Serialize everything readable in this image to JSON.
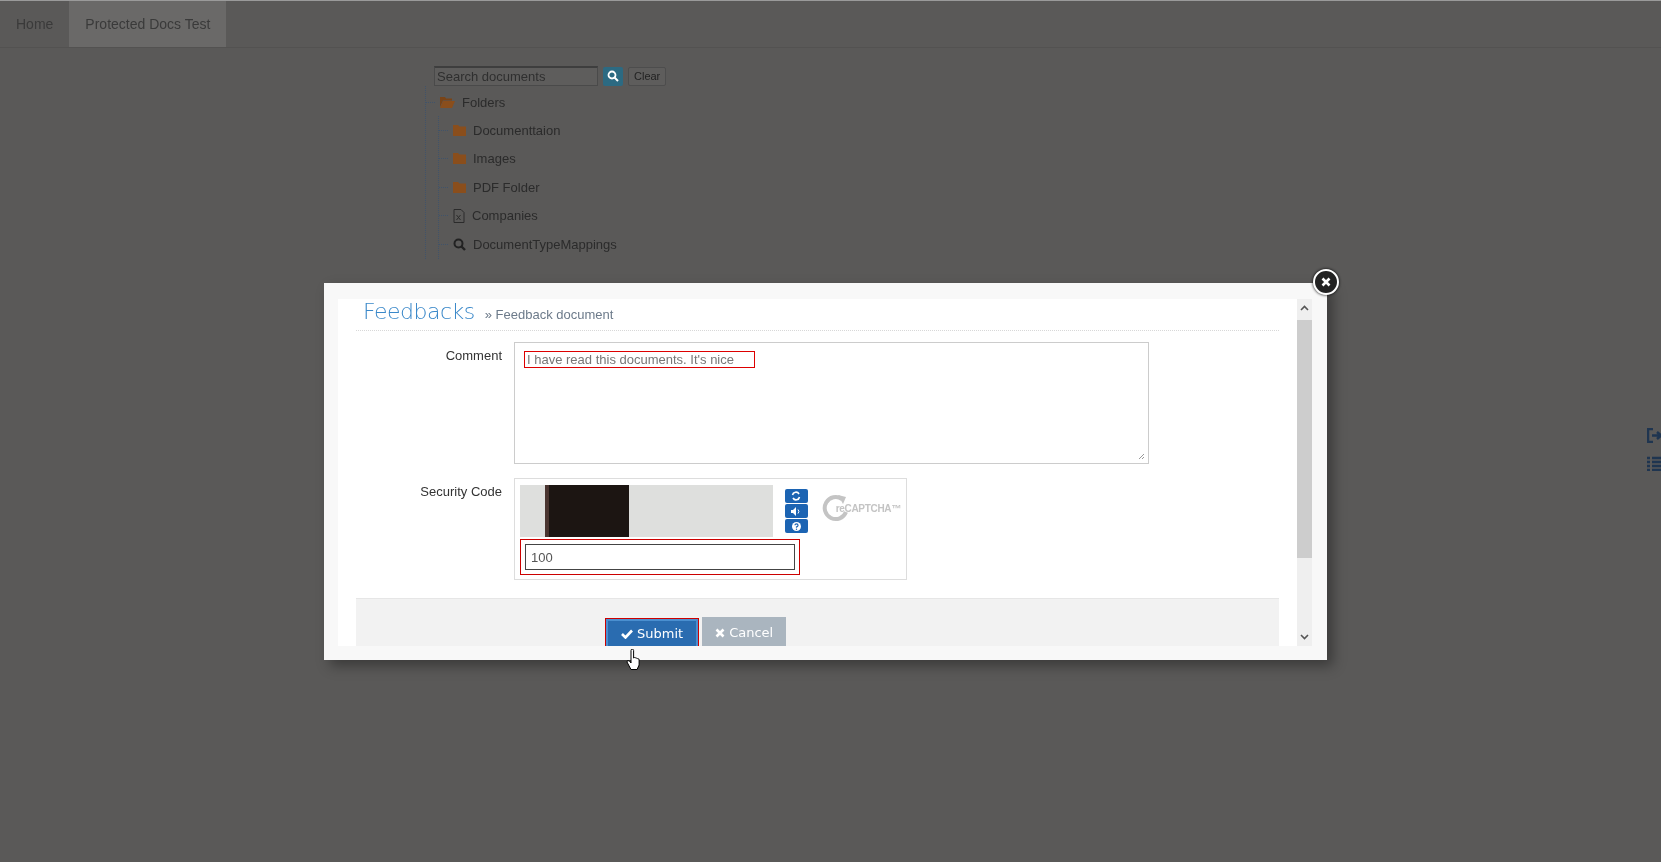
{
  "nav": {
    "tabs": [
      {
        "label": "Home",
        "selected": false
      },
      {
        "label": "Protected Docs Test",
        "selected": true
      }
    ]
  },
  "search": {
    "placeholder": "Search documents",
    "clear_label": "Clear"
  },
  "tree": {
    "label": "Folders",
    "expanded": true,
    "children": [
      {
        "label": "Documenttaion",
        "kind": "folder"
      },
      {
        "label": "Images",
        "kind": "folder"
      },
      {
        "label": "PDF Folder",
        "kind": "folder"
      },
      {
        "label": "Companies",
        "kind": "spreadsheet"
      },
      {
        "label": "DocumentTypeMappings",
        "kind": "query"
      }
    ]
  },
  "dialog": {
    "title": "Feedbacks",
    "breadcrumb": "» Feedback document",
    "fields": [
      {
        "label": "Comment",
        "kind": "textarea",
        "value": "I have read this documents. It's nice"
      },
      {
        "label": "Security Code",
        "kind": "captcha",
        "value": "100",
        "logo": "reCAPTCHA™"
      }
    ],
    "buttons": [
      {
        "label": "Submit",
        "kind": "primary"
      },
      {
        "label": "Cancel",
        "kind": "secondary"
      }
    ]
  }
}
